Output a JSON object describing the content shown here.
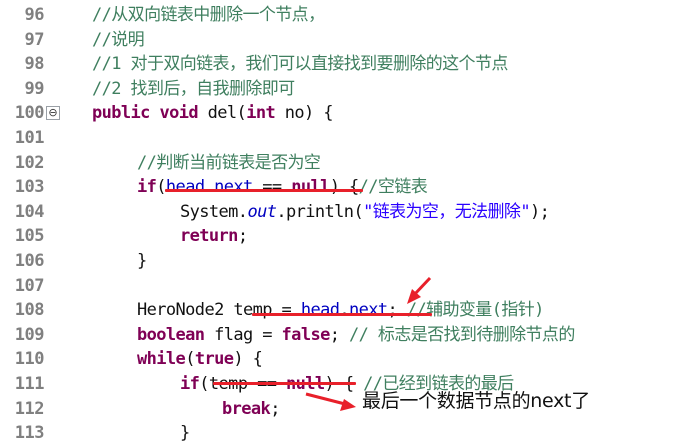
{
  "editor": {
    "lines": [
      {
        "no": "96",
        "segments": [
          {
            "cls": "cm",
            "t": "//从双向链表中删除一个节点，"
          }
        ],
        "indent": 92
      },
      {
        "no": "97",
        "segments": [
          {
            "cls": "cm",
            "t": "//说明"
          }
        ],
        "indent": 92
      },
      {
        "no": "98",
        "segments": [
          {
            "cls": "cm",
            "t": "//1 对于双向链表，我们可以直接找到要删除的这个节点"
          }
        ],
        "indent": 92
      },
      {
        "no": "99",
        "segments": [
          {
            "cls": "cm",
            "t": "//2 找到后，自我删除即可"
          }
        ],
        "indent": 92
      },
      {
        "no": "100",
        "fold": "⊖",
        "segments": [
          {
            "cls": "kw",
            "t": "public"
          },
          {
            "cls": "",
            "t": " "
          },
          {
            "cls": "kw",
            "t": "void"
          },
          {
            "cls": "",
            "t": " del("
          },
          {
            "cls": "kw",
            "t": "int"
          },
          {
            "cls": "",
            "t": " no) {"
          }
        ],
        "indent": 92
      },
      {
        "no": "101",
        "segments": [],
        "indent": 92
      },
      {
        "no": "102",
        "segments": [
          {
            "cls": "cm",
            "t": "//判断当前链表是否为空"
          }
        ],
        "indent": 137
      },
      {
        "no": "103",
        "segments": [
          {
            "cls": "kw",
            "t": "if"
          },
          {
            "cls": "",
            "t": "("
          },
          {
            "cls": "fld",
            "t": "head"
          },
          {
            "cls": "",
            "t": "."
          },
          {
            "cls": "fld",
            "t": "next"
          },
          {
            "cls": "",
            "t": " == "
          },
          {
            "cls": "kw",
            "t": "null"
          },
          {
            "cls": "",
            "t": ") {"
          },
          {
            "cls": "cm",
            "t": "//空链表"
          }
        ],
        "indent": 137
      },
      {
        "no": "104",
        "segments": [
          {
            "cls": "",
            "t": "System."
          },
          {
            "cls": "it",
            "t": "out"
          },
          {
            "cls": "",
            "t": ".println("
          },
          {
            "cls": "st",
            "t": "\"链表为空，无法删除\""
          },
          {
            "cls": "",
            "t": ");"
          }
        ],
        "indent": 180
      },
      {
        "no": "105",
        "segments": [
          {
            "cls": "kw",
            "t": "return"
          },
          {
            "cls": "",
            "t": ";"
          }
        ],
        "indent": 180
      },
      {
        "no": "106",
        "segments": [
          {
            "cls": "",
            "t": "}"
          }
        ],
        "indent": 137
      },
      {
        "no": "107",
        "segments": [],
        "indent": 137
      },
      {
        "no": "108",
        "segments": [
          {
            "cls": "",
            "t": "HeroNode2 "
          },
          {
            "cls": "",
            "t": "temp"
          },
          {
            "cls": "",
            "t": " = "
          },
          {
            "cls": "fld",
            "t": "head"
          },
          {
            "cls": "",
            "t": "."
          },
          {
            "cls": "fld",
            "t": "next"
          },
          {
            "cls": "",
            "t": "; "
          },
          {
            "cls": "cm",
            "t": "//辅助变量(指针)"
          }
        ],
        "indent": 137
      },
      {
        "no": "109",
        "segments": [
          {
            "cls": "kw",
            "t": "boolean"
          },
          {
            "cls": "",
            "t": " flag = "
          },
          {
            "cls": "kw",
            "t": "false"
          },
          {
            "cls": "",
            "t": "; "
          },
          {
            "cls": "cm",
            "t": "// 标志是否找到待删除节点的"
          }
        ],
        "indent": 137
      },
      {
        "no": "110",
        "segments": [
          {
            "cls": "kw",
            "t": "while"
          },
          {
            "cls": "",
            "t": "("
          },
          {
            "cls": "kw",
            "t": "true"
          },
          {
            "cls": "",
            "t": ") {"
          }
        ],
        "indent": 137
      },
      {
        "no": "111",
        "segments": [
          {
            "cls": "kw",
            "t": "if"
          },
          {
            "cls": "",
            "t": "(temp == "
          },
          {
            "cls": "kw",
            "t": "null"
          },
          {
            "cls": "",
            "t": ") { "
          },
          {
            "cls": "cm",
            "t": "//已经到链表的最后"
          }
        ],
        "indent": 180
      },
      {
        "no": "112",
        "segments": [
          {
            "cls": "kw",
            "t": "break"
          },
          {
            "cls": "",
            "t": ";"
          }
        ],
        "indent": 222
      },
      {
        "no": "113",
        "segments": [
          {
            "cls": "",
            "t": "}"
          }
        ],
        "indent": 180
      }
    ]
  },
  "annotation": {
    "caption": "最后一个数据节点的next了",
    "color": "#e8202a"
  }
}
